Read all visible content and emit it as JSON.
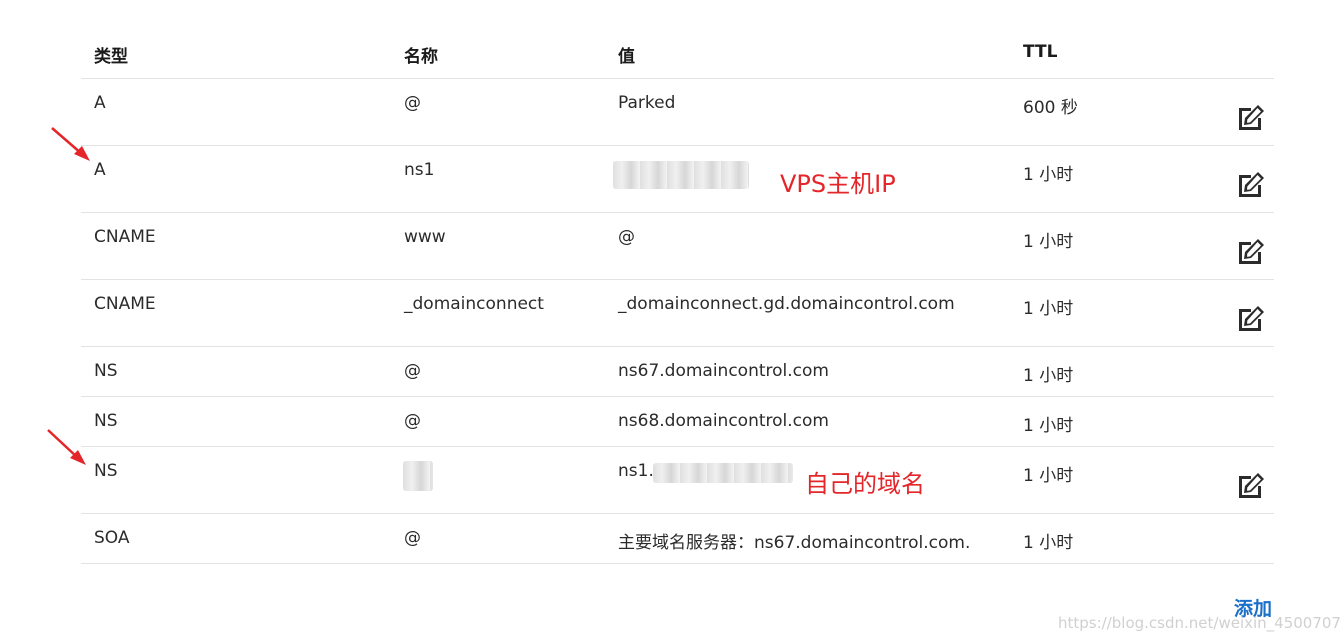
{
  "table": {
    "headers": {
      "type": "类型",
      "name": "名称",
      "value": "值",
      "ttl": "TTL"
    },
    "rows": [
      {
        "type": "A",
        "name": "@",
        "value": "Parked",
        "ttl": "600 秒"
      },
      {
        "type": "A",
        "name": "ns1",
        "value": "",
        "ttl": "1 小时"
      },
      {
        "type": "CNAME",
        "name": "www",
        "value": "@",
        "ttl": "1 小时"
      },
      {
        "type": "CNAME",
        "name": "_domainconnect",
        "value": "_domainconnect.gd.domaincontrol.com",
        "ttl": "1 小时"
      },
      {
        "type": "NS",
        "name": "@",
        "value": "ns67.domaincontrol.com",
        "ttl": "1 小时"
      },
      {
        "type": "NS",
        "name": "@",
        "value": "ns68.domaincontrol.com",
        "ttl": "1 小时"
      },
      {
        "type": "NS",
        "name": "",
        "value": "ns1.",
        "ttl": "1 小时"
      },
      {
        "type": "SOA",
        "name": "@",
        "value": "主要域名服务器：ns67.domaincontrol.com.",
        "ttl": "1 小时"
      }
    ]
  },
  "annotations": {
    "vps_ip": "VPS主机IP",
    "own_domain": "自己的域名"
  },
  "actions": {
    "add_label": "添加"
  },
  "watermark": "https://blog.csdn.net/weixin_45007073",
  "colors": {
    "annotation": "#e4262a",
    "link": "#1a6fc9",
    "divider": "#e3e3e3"
  },
  "icons": {
    "edit": "edit-icon",
    "annotation_arrow": "red-arrow-icon"
  }
}
